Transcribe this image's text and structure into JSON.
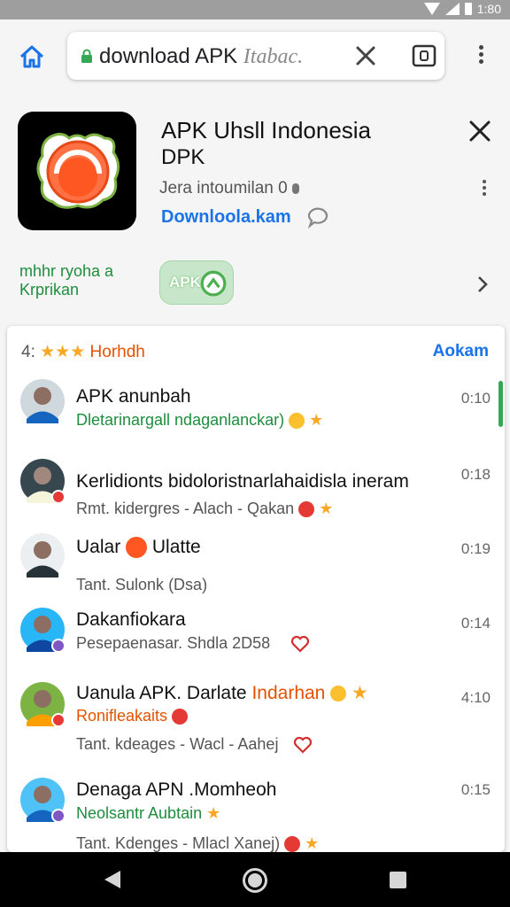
{
  "status_bar": {
    "time": "1:80"
  },
  "browser": {
    "url_text": "download APK",
    "url_hint": "Itabac."
  },
  "app": {
    "title": "APK Uhsll Indonesia",
    "subtitle": "DPK",
    "developer_line": "Jera intoumilan 0",
    "download_label": "Downloola.kam",
    "promo_line1": "mhhr ryoha a",
    "promo_line2": "Krprikan",
    "promo_badge": "APK"
  },
  "comments": {
    "header_count": "4:",
    "header_stars": "★★★",
    "header_label": "Horhdh",
    "header_action": "Aokam",
    "items": [
      {
        "name": "APK anunbah",
        "line2": "Dletarinargall ndaganlanckar)",
        "time": "0:10"
      },
      {
        "name": "Kerlidionts bidoloristnarlahaidisla ineram",
        "line2": "Rmt. kidergres - Alach - Qakan",
        "time": "0:18"
      },
      {
        "name_a": "Ualar",
        "name_b": "Ulatte",
        "line2": "Tant. Sulonk (Dsa)",
        "time": "0:19"
      },
      {
        "name": "Dakanfiokara",
        "line2": "Pesepaenasar. Shdla 2D58",
        "time": "0:14"
      },
      {
        "name": "Uanula APK. Darlate",
        "name_tail": "Indarhan",
        "line2": "Ronifleakaits",
        "line3": "Tant. kdeages - Wacl - Aahej",
        "time": "4:10"
      },
      {
        "name": "Denaga APN .Momheoh",
        "line2": "Neolsantr Aubtain",
        "line3": "Tant. Kdenges - Mlacl Xanej)",
        "time": "0:15"
      }
    ]
  },
  "colors": {
    "accent_blue": "#1a73e8",
    "accent_green": "#1e8e3e",
    "accent_orange": "#e65100",
    "star": "#f9a825"
  },
  "icons": {
    "home": "home-icon",
    "lock": "lock-icon",
    "clear": "close-icon",
    "tabs": "tabs-icon",
    "menu": "more-vert-icon",
    "chat": "chat-bubble-icon",
    "chevron": "chevron-right-icon",
    "nav_back": "back-icon",
    "nav_home": "home-circle-icon",
    "nav_recent": "recent-apps-icon"
  }
}
